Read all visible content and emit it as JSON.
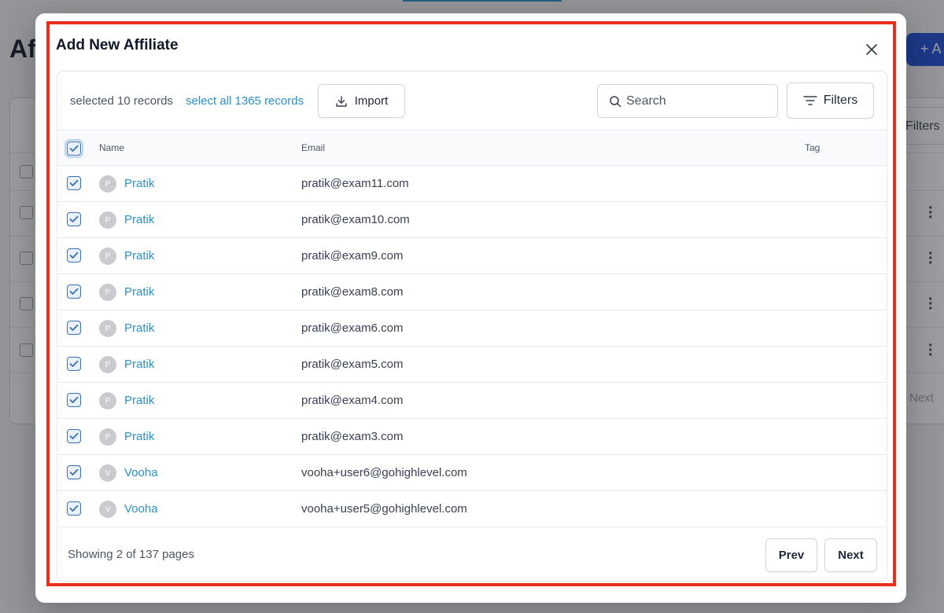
{
  "background": {
    "page_title": "Af",
    "add_button_label": "+ A",
    "filters_label": "Filters",
    "next_label": "Next"
  },
  "modal": {
    "title": "Add New Affiliate",
    "close_icon": "close-icon",
    "toolbar": {
      "selected_text": "selected 10 records",
      "select_all_text": "select all 1365 records",
      "import_label": "Import",
      "import_icon": "download-icon",
      "search_placeholder": "Search",
      "search_value": "",
      "search_icon": "search-icon",
      "filters_label": "Filters",
      "filters_icon": "filter-lines-icon"
    },
    "table": {
      "columns": [
        "Name",
        "Email",
        "Tag"
      ],
      "header_checked": true,
      "rows": [
        {
          "initial": "P",
          "name": "Pratik",
          "email": "pratik@exam11.com",
          "tag": "",
          "checked": true
        },
        {
          "initial": "P",
          "name": "Pratik",
          "email": "pratik@exam10.com",
          "tag": "",
          "checked": true
        },
        {
          "initial": "P",
          "name": "Pratik",
          "email": "pratik@exam9.com",
          "tag": "",
          "checked": true
        },
        {
          "initial": "P",
          "name": "Pratik",
          "email": "pratik@exam8.com",
          "tag": "",
          "checked": true
        },
        {
          "initial": "P",
          "name": "Pratik",
          "email": "pratik@exam6.com",
          "tag": "",
          "checked": true
        },
        {
          "initial": "P",
          "name": "Pratik",
          "email": "pratik@exam5.com",
          "tag": "",
          "checked": true
        },
        {
          "initial": "P",
          "name": "Pratik",
          "email": "pratik@exam4.com",
          "tag": "",
          "checked": true
        },
        {
          "initial": "P",
          "name": "Pratik",
          "email": "pratik@exam3.com",
          "tag": "",
          "checked": true
        },
        {
          "initial": "V",
          "name": "Vooha",
          "email": "vooha+user6@gohighlevel.com",
          "tag": "",
          "checked": true
        },
        {
          "initial": "V",
          "name": "Vooha",
          "email": "vooha+user5@gohighlevel.com",
          "tag": "",
          "checked": true
        }
      ]
    },
    "footer": {
      "showing_text": "Showing 2 of 137 pages",
      "prev_label": "Prev",
      "next_label": "Next"
    }
  },
  "colors": {
    "accent": "#2a90c8",
    "highlight_border": "#ea2e1c",
    "checkbox": "#3a6fb0"
  }
}
